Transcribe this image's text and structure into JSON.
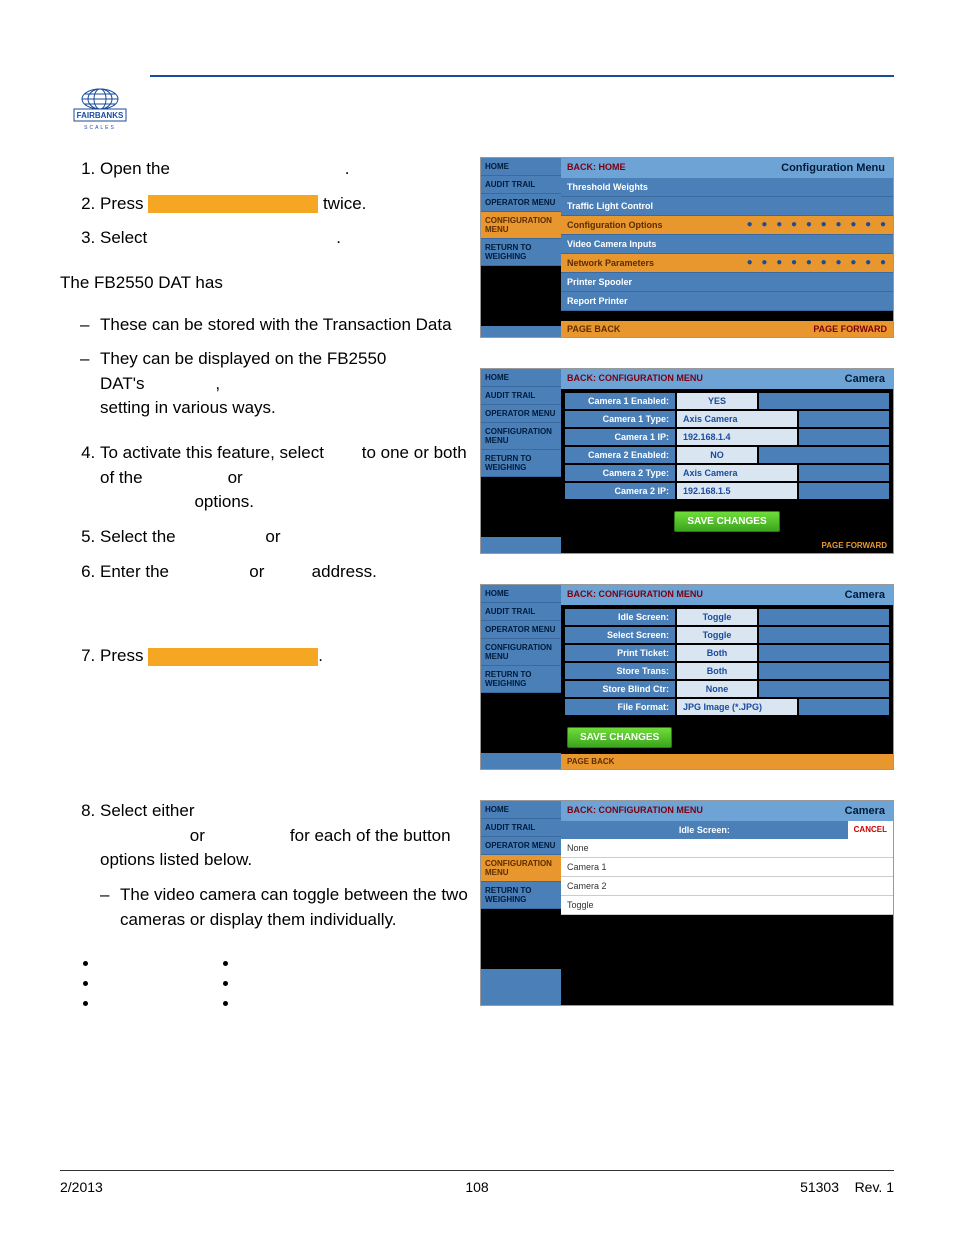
{
  "footer": {
    "date": "2/2013",
    "page": "108",
    "doc": "51303",
    "rev": "Rev. 1"
  },
  "steps": {
    "s1a": "Open the",
    "s1b": ".",
    "s2a": "Press",
    "s2b": "twice.",
    "s3a": "Select",
    "s3b": ".",
    "intro": "The FB2550 DAT has",
    "d1": "These can be stored with the Transaction Data",
    "d2a": "They can be displayed on the FB2550 DAT's",
    "d2b": ",",
    "d2c": "setting  in various ways.",
    "s4a": "To activate this feature, select",
    "s4b": "to one or both of the",
    "s4c": "or",
    "s4d": "options.",
    "s5a": "Select the",
    "s5b": "or",
    "s6a": "Enter the",
    "s6b": "or",
    "s6c": "address.",
    "s7a": "Press",
    "s7b": ".",
    "s8a": "Select either",
    "s8b": "or",
    "s8c": "for each of the button options listed below.",
    "d3": "The video camera can toggle between the two cameras or display them individually."
  },
  "ss1": {
    "side": [
      "HOME",
      "AUDIT TRAIL",
      "OPERATOR MENU",
      "CONFIGURATION MENU",
      "RETURN TO WEIGHING"
    ],
    "back": "BACK: HOME",
    "title": "Configuration Menu",
    "items": [
      "Threshold Weights",
      "Traffic Light Control",
      "Configuration Options",
      "Video Camera Inputs",
      "Network Parameters",
      "Printer Spooler",
      "Report Printer"
    ],
    "hl": [
      2,
      4
    ],
    "foot_l": "PAGE BACK",
    "foot_r": "PAGE FORWARD"
  },
  "ss2": {
    "side": [
      "HOME",
      "AUDIT TRAIL",
      "OPERATOR MENU",
      "CONFIGURATION MENU",
      "RETURN TO WEIGHING"
    ],
    "back": "BACK: CONFIGURATION MENU",
    "title": "Camera",
    "rows": [
      {
        "l": "Camera 1 Enabled:",
        "v": "YES",
        "t": "val"
      },
      {
        "l": "Camera 1 Type:",
        "v": "Axis Camera",
        "t": "valwide"
      },
      {
        "l": "Camera 1 IP:",
        "v": "192.168.1.4",
        "t": "valwide"
      },
      {
        "l": "Camera 2 Enabled:",
        "v": "NO",
        "t": "val"
      },
      {
        "l": "Camera 2 Type:",
        "v": "Axis Camera",
        "t": "valwide"
      },
      {
        "l": "Camera 2 IP:",
        "v": "192.168.1.5",
        "t": "valwide"
      }
    ],
    "save": "SAVE CHANGES",
    "foot_r": "PAGE FORWARD"
  },
  "ss3": {
    "side": [
      "HOME",
      "AUDIT TRAIL",
      "OPERATOR MENU",
      "CONFIGURATION MENU",
      "RETURN TO WEIGHING"
    ],
    "back": "BACK: CONFIGURATION MENU",
    "title": "Camera",
    "rows": [
      {
        "l": "Idle Screen:",
        "v": "Toggle",
        "t": "val"
      },
      {
        "l": "Select Screen:",
        "v": "Toggle",
        "t": "val"
      },
      {
        "l": "Print Ticket:",
        "v": "Both",
        "t": "val"
      },
      {
        "l": "Store Trans:",
        "v": "Both",
        "t": "val"
      },
      {
        "l": "Store Blind Ctr:",
        "v": "None",
        "t": "val"
      },
      {
        "l": "File Format:",
        "v": "JPG Image (*.JPG)",
        "t": "valwide"
      }
    ],
    "save": "SAVE CHANGES",
    "foot_l": "PAGE BACK"
  },
  "ss4": {
    "side": [
      "HOME",
      "AUDIT TRAIL",
      "OPERATOR MENU",
      "CONFIGURATION MENU",
      "RETURN TO WEIGHING"
    ],
    "back": "BACK: CONFIGURATION MENU",
    "title": "Camera",
    "idle_label": "Idle Screen:",
    "cancel": "CANCEL",
    "opts": [
      "None",
      "Camera 1",
      "Camera 2",
      "Toggle"
    ]
  }
}
